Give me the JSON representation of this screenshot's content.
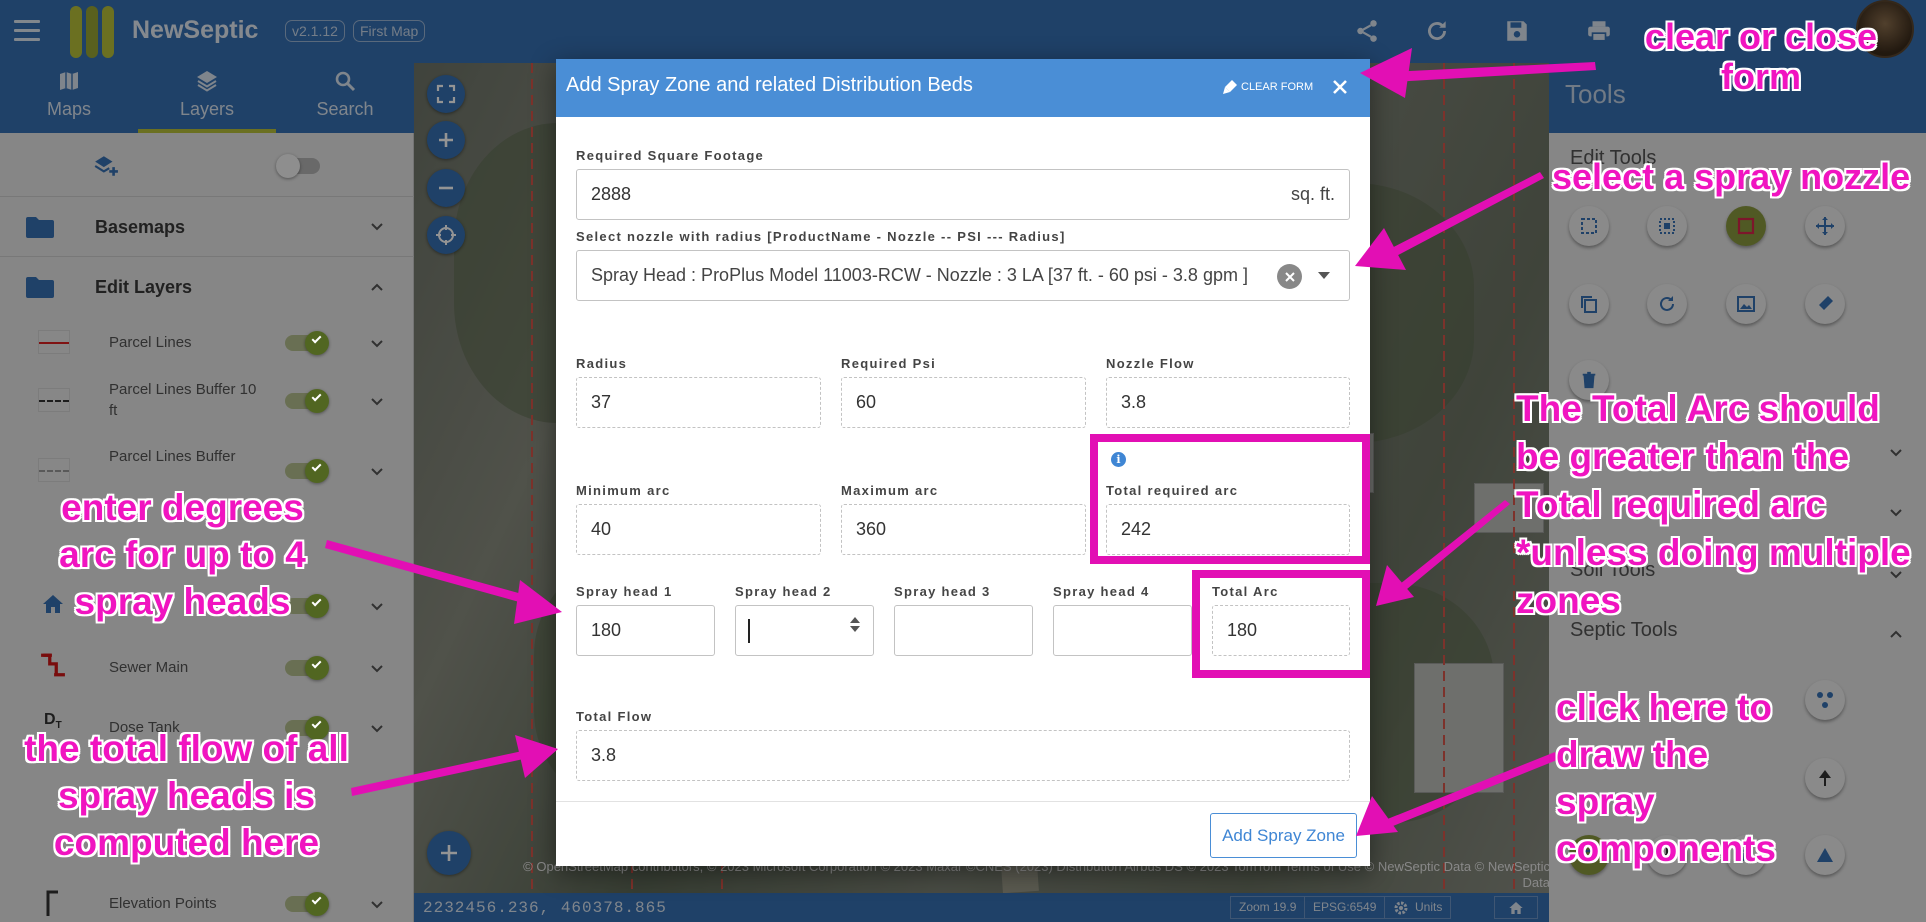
{
  "app": {
    "brand": "NewSeptic",
    "version": "v2.1.12",
    "map_name": "First Map",
    "accent": "#3670b3",
    "highlight": "#e20fb4"
  },
  "toolbar_icons": [
    "share-icon",
    "refresh-icon",
    "save-icon",
    "print-icon",
    "user-avatar"
  ],
  "left_panel": {
    "tabs": [
      {
        "label": "Maps",
        "icon": "map-icon"
      },
      {
        "label": "Layers",
        "icon": "layers-icon",
        "active": true
      },
      {
        "label": "Search",
        "icon": "search-icon"
      }
    ],
    "groups": [
      {
        "label": "Basemaps"
      },
      {
        "label": "Edit Layers"
      }
    ],
    "layers": [
      {
        "label": "Parcel Lines",
        "on": true
      },
      {
        "label": "Parcel Lines Buffer 10 ft",
        "on": true
      },
      {
        "label": "Parcel Lines Buffer",
        "on": true
      },
      {
        "label": "Sewer Main",
        "on": true
      },
      {
        "label": "Dose Tank",
        "on": true
      },
      {
        "label": "Elevation Points",
        "on": true
      }
    ]
  },
  "map": {
    "attribution": "© OpenStreetMap contributors, © 2023 Microsoft Corporation © 2023 Maxar ©CNES (2023) Distribution Airbus DS © 2023 TomTom Terms of Use © NewSeptic Data © NewSeptic Data",
    "coordinates": "2232456.236, 460378.865",
    "zoom": "Zoom 19.9",
    "epsg": "EPSG:6549",
    "units_label": "Units"
  },
  "right_panel": {
    "title": "Tools",
    "sections": [
      {
        "label": "Edit Tools"
      },
      {
        "label": "Soil Tools"
      },
      {
        "label": "Septic Tools"
      }
    ]
  },
  "dialog": {
    "title": "Add Spray Zone and related Distribution Beds",
    "clear_form": "CLEAR FORM",
    "required_sqft": {
      "label": "Required Square Footage",
      "value": "2888",
      "suffix": "sq. ft."
    },
    "nozzle": {
      "label": "Select nozzle with radius [ProductName - Nozzle -- PSI --- Radius]",
      "value": "Spray Head : ProPlus Model 11003-RCW - Nozzle : 3 LA [37 ft. - 60 psi - 3.8 gpm ]"
    },
    "radius": {
      "label": "Radius",
      "value": "37"
    },
    "required_psi": {
      "label": "Required Psi",
      "value": "60"
    },
    "nozzle_flow": {
      "label": "Nozzle Flow",
      "value": "3.8"
    },
    "minimum_arc": {
      "label": "Minimum arc",
      "value": "40"
    },
    "maximum_arc": {
      "label": "Maximum arc",
      "value": "360"
    },
    "total_required_arc": {
      "label": "Total required arc",
      "value": "242"
    },
    "spray_heads": [
      {
        "label": "Spray head 1",
        "value": "180"
      },
      {
        "label": "Spray head 2",
        "value": ""
      },
      {
        "label": "Spray head 3",
        "value": ""
      },
      {
        "label": "Spray head 4",
        "value": ""
      }
    ],
    "total_arc": {
      "label": "Total Arc",
      "value": "180"
    },
    "total_flow": {
      "label": "Total Flow",
      "value": "3.8"
    },
    "submit": "Add Spray Zone"
  },
  "annotations": {
    "clear_close": "clear or close form",
    "select_nozzle": "select a spray nozzle",
    "total_arc_note": "The Total Arc should be greater than the Total required arc *unless doing multiple zones",
    "enter_degrees": "enter degrees arc for up to 4 spray heads",
    "total_flow_note": "the total flow of all spray heads is computed here",
    "click_here": "click here to draw the spray components"
  }
}
